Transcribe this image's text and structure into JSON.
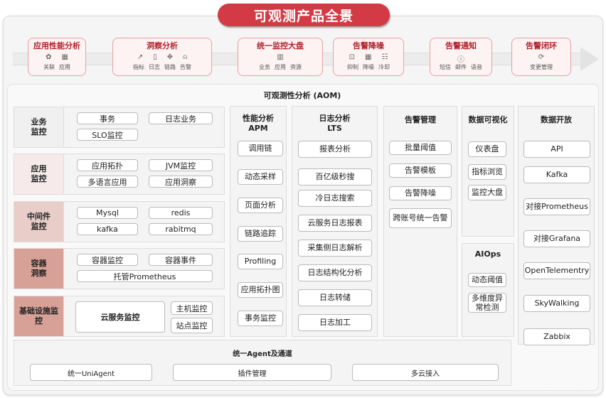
{
  "title": "可观测产品全景",
  "colors": {
    "brand_red": "#d33a45",
    "stage_title": "#b3202b",
    "stage_border": "#e8a0a4"
  },
  "stages": [
    {
      "title": "应用性能分析",
      "icons": [
        "link-icon",
        "grid-icon"
      ],
      "labels": [
        "关联",
        "应用"
      ]
    },
    {
      "title": "洞察分析",
      "icons": [
        "trend-icon",
        "log-icon",
        "trace-icon",
        "alarm-icon"
      ],
      "labels": [
        "指标",
        "日志",
        "链路",
        "告警"
      ]
    },
    {
      "title": "统一监控大盘",
      "icons": [
        "dashboard-icon"
      ],
      "labels": [
        "业务",
        "应用",
        "资源"
      ]
    },
    {
      "title": "告警降噪",
      "icons": [
        "suppress-icon",
        "grid-icon",
        "slider-icon"
      ],
      "labels": [
        "抑制",
        "降噪",
        "冷却"
      ]
    },
    {
      "title": "告警通知",
      "icons": [
        "notify-icon"
      ],
      "labels": [
        "短信",
        "邮件",
        "语音"
      ]
    },
    {
      "title": "告警闭环",
      "icons": [
        "cycle-icon"
      ],
      "labels": [
        "变更管理"
      ]
    }
  ],
  "aom_title": "可观测性分析 (AOM)",
  "rows": [
    {
      "label": "业务\n监控",
      "items": [
        "事务",
        "日志业务",
        "SLO监控"
      ]
    },
    {
      "label": "应用\n监控",
      "items": [
        "应用拓扑",
        "JVM监控",
        "多语言应用",
        "应用洞察"
      ]
    },
    {
      "label": "中间件\n监控",
      "items": [
        "Mysql",
        "redis",
        "kafka",
        "rabitmq"
      ]
    },
    {
      "label": "容器\n洞察",
      "items": [
        "容器监控",
        "容器事件",
        "托管Prometheus"
      ]
    },
    {
      "label": "基础设施监\n控",
      "items": [
        "云服务监控",
        "主机监控",
        "站点监控"
      ]
    }
  ],
  "apm": {
    "title": "性能分析\nAPM",
    "items": [
      "调用链",
      "动态采样",
      "页面分析",
      "链路追踪",
      "Profiling",
      "应用拓扑图",
      "事务监控"
    ]
  },
  "lts": {
    "title": "日志分析\nLTS",
    "items": [
      "报表分析",
      "百亿级秒搜",
      "冷日志搜索",
      "云服务日志报表",
      "采集侧日志解析",
      "日志结构化分析",
      "日志转储",
      "日志加工"
    ]
  },
  "alarm": {
    "title": "告警管理",
    "items": [
      "批量阈值",
      "告警模板",
      "告警降噪",
      "跨账号统一告警"
    ]
  },
  "viz": {
    "title": "数据可视化",
    "items": [
      "仪表盘",
      "指标浏览",
      "监控大盘"
    ]
  },
  "aiops": {
    "title": "AIOps",
    "items": [
      "动态阈值",
      "多维度异\n常检测"
    ]
  },
  "open": {
    "title": "数据开放",
    "items": [
      "API",
      "Kafka",
      "对接Prometheus",
      "对接Grafana",
      "OpenTelementry",
      "SkyWalking",
      "Zabbix"
    ]
  },
  "agent": {
    "title": "统一Agent及通道",
    "items": [
      "统一UniAgent",
      "插件管理",
      "多云接入"
    ]
  }
}
